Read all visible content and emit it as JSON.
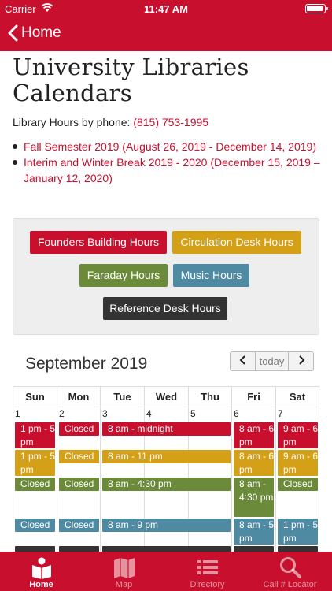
{
  "status": {
    "carrier": "Carrier",
    "time": "11:47 AM"
  },
  "nav": {
    "back_label": "Home"
  },
  "page": {
    "title": "University Libraries Calendars",
    "phone_prefix": "Library Hours by phone: ",
    "phone_number": "(815) 753-1995",
    "semesters": [
      {
        "label": "Fall Semester 2019 (August 26, 2019 - December 14, 2019)"
      },
      {
        "label": "Interim and Winter Break 2019 - 2020 (December 15, 2019 – January 12, 2020)"
      }
    ]
  },
  "hour_buttons": [
    {
      "label": "Founders Building Hours",
      "color": "#c8102e"
    },
    {
      "label": "Circulation Desk Hours",
      "color": "#d4a017"
    },
    {
      "label": "Faraday Hours",
      "color": "#6b8a3a"
    },
    {
      "label": "Music Hours",
      "color": "#4f8aa3"
    },
    {
      "label": "Reference Desk Hours",
      "color": "#333333"
    }
  ],
  "calendar": {
    "month": "September 2019",
    "today_label": "today",
    "days": [
      "Sun",
      "Mon",
      "Tue",
      "Wed",
      "Thu",
      "Fri",
      "Sat"
    ],
    "dates": [
      "1",
      "2",
      "3",
      "4",
      "5",
      "6",
      "7"
    ],
    "events": [
      {
        "text": "1 pm - 5 pm",
        "color": "#c8102e"
      },
      {
        "text": "Closed",
        "color": "#c8102e"
      },
      {
        "text": "8 am - midnight",
        "color": "#c8102e"
      },
      {
        "text": "8 am - 6 pm",
        "color": "#c8102e"
      },
      {
        "text": "9 am - 6 pm",
        "color": "#c8102e"
      },
      {
        "text": "1 pm - 5 pm",
        "color": "#d4a017"
      },
      {
        "text": "Closed",
        "color": "#d4a017"
      },
      {
        "text": "8 am - 11 pm",
        "color": "#d4a017"
      },
      {
        "text": "8 am - 6 pm",
        "color": "#d4a017"
      },
      {
        "text": "9 am - 6 pm",
        "color": "#d4a017"
      },
      {
        "text": "Closed",
        "color": "#6b8a3a"
      },
      {
        "text": "Closed",
        "color": "#6b8a3a"
      },
      {
        "text": "8 am - 4:30 pm",
        "color": "#6b8a3a"
      },
      {
        "text": "8 am - 4:30 pm",
        "color": "#6b8a3a"
      },
      {
        "text": "Closed",
        "color": "#6b8a3a"
      },
      {
        "text": "Closed",
        "color": "#4f8aa3"
      },
      {
        "text": "Closed",
        "color": "#4f8aa3"
      },
      {
        "text": "8 am - 9 pm",
        "color": "#4f8aa3"
      },
      {
        "text": "8 am - 5 pm",
        "color": "#4f8aa3"
      },
      {
        "text": "1 pm - 5 pm",
        "color": "#4f8aa3"
      }
    ]
  },
  "tabs": [
    {
      "label": "Home",
      "icon": "book-reader-icon"
    },
    {
      "label": "Map",
      "icon": "map-icon"
    },
    {
      "label": "Directory",
      "icon": "list-icon"
    },
    {
      "label": "Call # Locator",
      "icon": "search-icon"
    }
  ]
}
